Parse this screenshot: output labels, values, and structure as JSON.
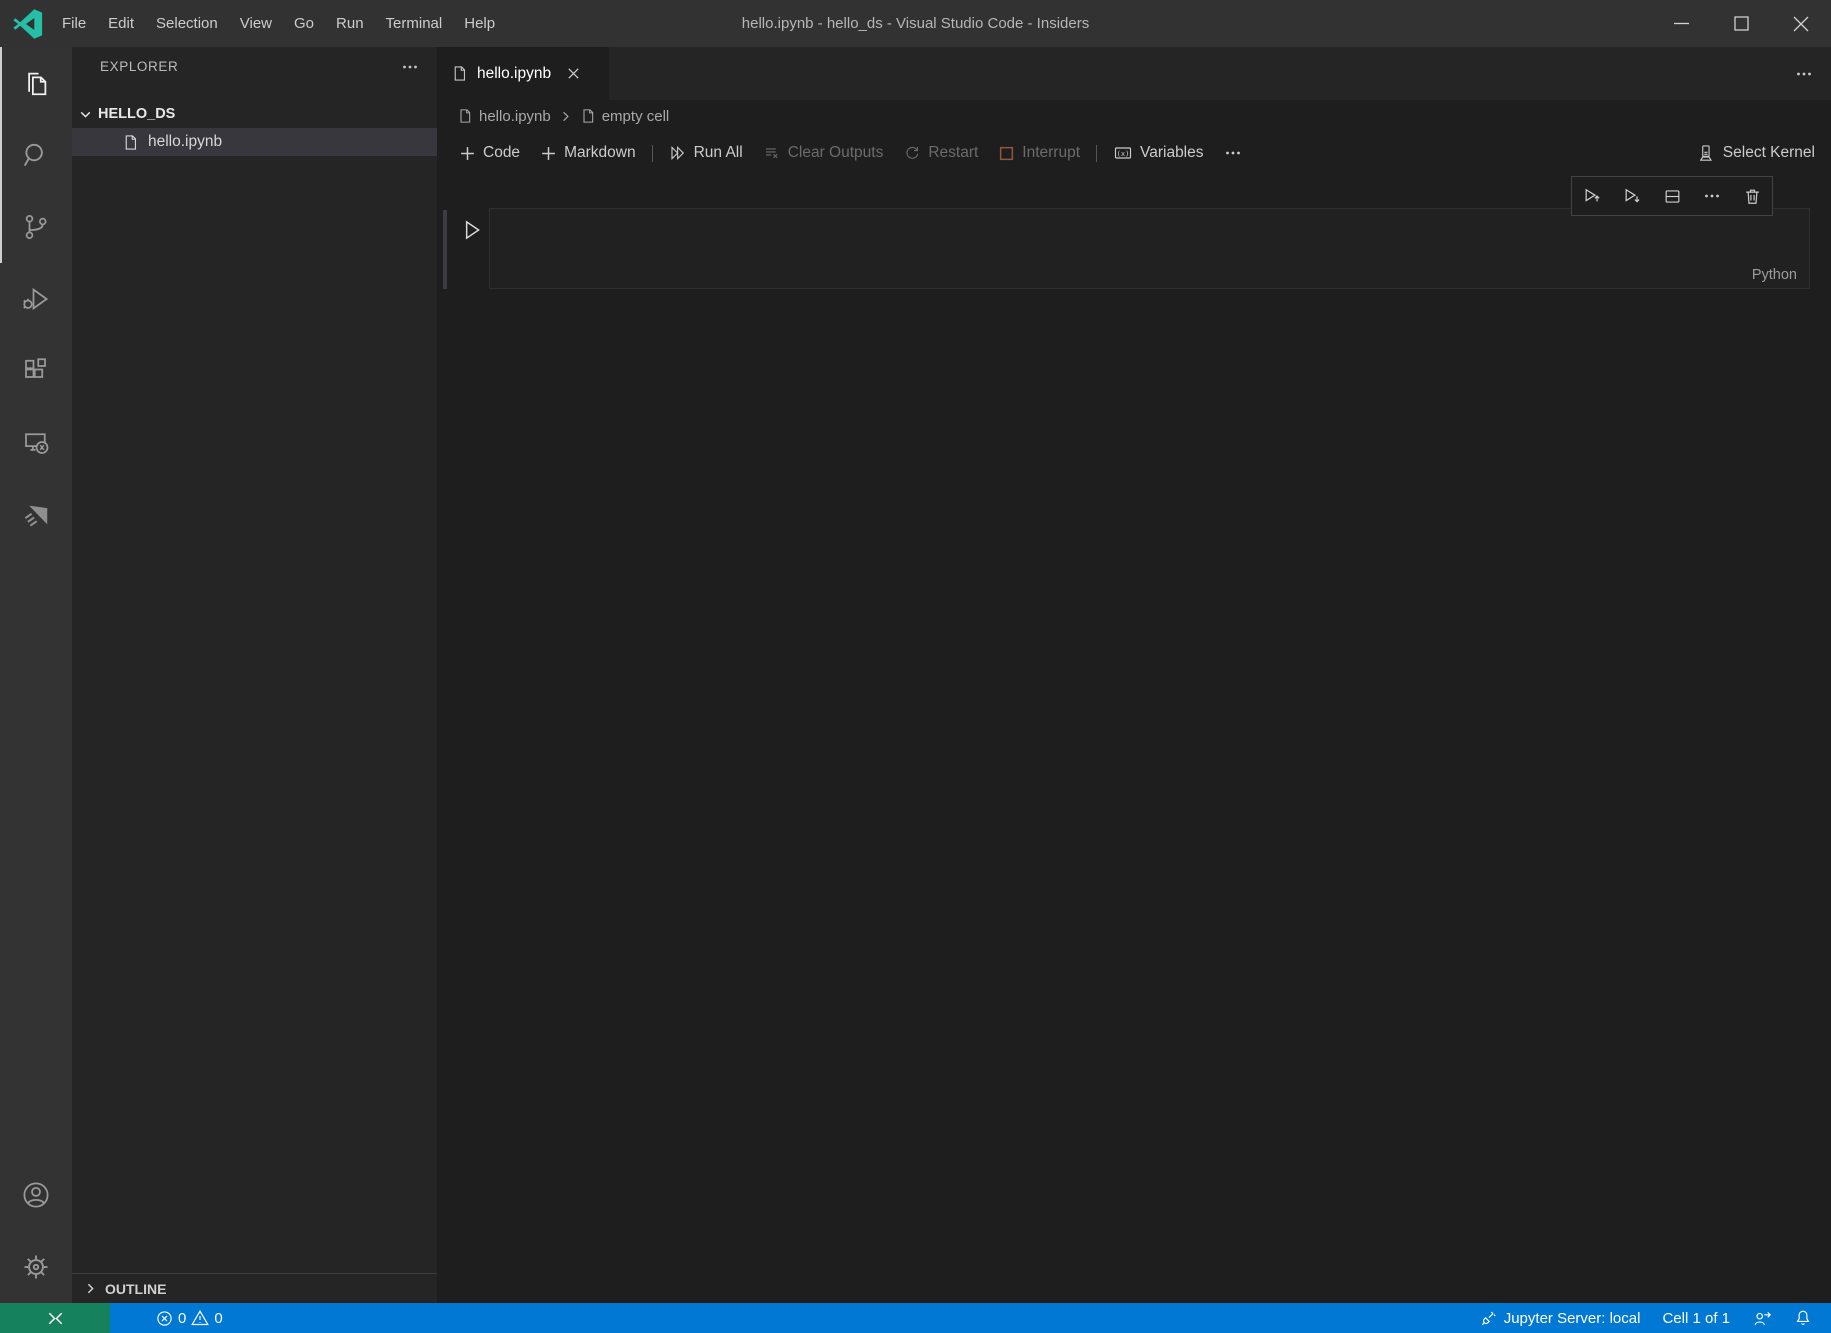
{
  "titlebar": {
    "menus": [
      "File",
      "Edit",
      "Selection",
      "View",
      "Go",
      "Run",
      "Terminal",
      "Help"
    ],
    "title": "hello.ipynb - hello_ds - Visual Studio Code - Insiders"
  },
  "activity_bar": {
    "items": [
      {
        "label": "Explorer",
        "icon": "files-icon",
        "active": true
      },
      {
        "label": "Search",
        "icon": "search-icon"
      },
      {
        "label": "Source Control",
        "icon": "source-control-icon"
      },
      {
        "label": "Run and Debug",
        "icon": "debug-icon"
      },
      {
        "label": "Extensions",
        "icon": "extensions-icon"
      },
      {
        "label": "Remote Explorer",
        "icon": "remote-explorer-icon"
      },
      {
        "label": "Extension",
        "icon": "paper-plane-icon"
      }
    ],
    "bottom_items": [
      {
        "label": "Accounts",
        "icon": "account-icon"
      },
      {
        "label": "Manage",
        "icon": "gear-icon"
      }
    ]
  },
  "sidebar": {
    "header": "EXPLORER",
    "folder": "HELLO_DS",
    "files": [
      {
        "label": "hello.ipynb",
        "selected": true
      }
    ],
    "outline_label": "OUTLINE"
  },
  "editor": {
    "tab": {
      "label": "hello.ipynb"
    },
    "breadcrumbs": [
      "hello.ipynb",
      "empty cell"
    ],
    "toolbar": {
      "code": "Code",
      "markdown": "Markdown",
      "run_all": "Run All",
      "clear_outputs": "Clear Outputs",
      "restart": "Restart",
      "interrupt": "Interrupt",
      "variables": "Variables",
      "select_kernel": "Select Kernel"
    },
    "cell": {
      "language": "Python"
    }
  },
  "status_bar": {
    "errors": "0",
    "warnings": "0",
    "jupyter_server": "Jupyter Server: local",
    "cell_indicator": "Cell 1 of 1"
  },
  "colors": {
    "accent_blue": "#0078d4",
    "remote_green": "#16825d",
    "titlebar_bg": "#323233",
    "activitybar_bg": "#333333",
    "sidebar_bg": "#252526",
    "editor_bg": "#1e1e1e",
    "selection_bg": "#37373d",
    "logo_teal": "#24bfa5"
  }
}
